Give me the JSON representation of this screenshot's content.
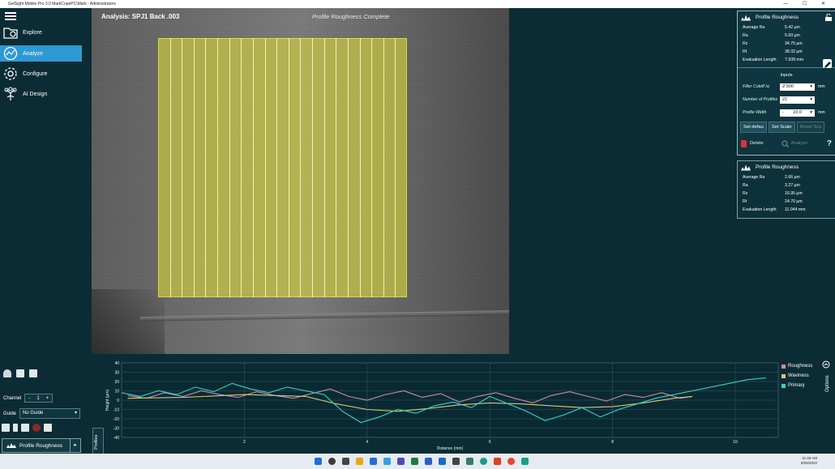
{
  "window": {
    "title": "GelSight Mobile Pro 3.0   MarkCopePC\\Mark - Administrators"
  },
  "nav": {
    "items": [
      {
        "label": "Explore",
        "icon": "folder-search-icon",
        "active": false
      },
      {
        "label": "Analyze",
        "icon": "analyze-icon",
        "active": true
      },
      {
        "label": "Configure",
        "icon": "gear-icon",
        "active": false
      },
      {
        "label": "AI Design",
        "icon": "ai-tree-icon",
        "active": false
      }
    ]
  },
  "viewer": {
    "title": "Analysis: SPJ1 Back .003",
    "status": "Profile Roughness  Complete",
    "roi_color": "#d6d63c",
    "profile_lines": 21
  },
  "panel1": {
    "title": "Profile Roughness",
    "metrics": [
      {
        "k": "Average Ra",
        "v": "5.42 µm"
      },
      {
        "k": "Ra",
        "v": "5.69 µm"
      },
      {
        "k": "Rz",
        "v": "34.75 µm"
      },
      {
        "k": "Rt",
        "v": "38.32 µm"
      },
      {
        "k": "Evaluation Length",
        "v": "7.939 mm"
      }
    ],
    "inputs_title": "Inputs",
    "filter_label": "Filter Cutoff λc",
    "filter_value": "2.500",
    "filter_unit": "mm",
    "profiles_label": "Number of Profiles",
    "profiles_value": "21",
    "width_label": "Profile Width",
    "width_value": "10.0",
    "width_unit": "mm",
    "buttons": {
      "set_default": "Set defau",
      "set_scale": "Set Scale",
      "reset_scale": "Reset Sca"
    },
    "delete_label": "Delete",
    "analyze_label": "Analyze",
    "help_label": "?"
  },
  "panel2": {
    "title": "Profile Roughness",
    "metrics": [
      {
        "k": "Average Ra",
        "v": "2.66 µm"
      },
      {
        "k": "Ra",
        "v": "3.27 µm"
      },
      {
        "k": "Rz",
        "v": "16.95 µm"
      },
      {
        "k": "Rt",
        "v": "24.70 µm"
      },
      {
        "k": "Evaluation Length",
        "v": "11.044 mm"
      }
    ]
  },
  "controls": {
    "channel_label": "Channel",
    "channel_value": "1",
    "guide_label": "Guide",
    "guide_value": "No Guide",
    "profile_button": "Profile Roughness",
    "profiles_tab": "Profiles",
    "options_tab": "Options"
  },
  "chart_data": {
    "type": "line",
    "xlabel": "Distance (mm)",
    "ylabel": "Height (µm)",
    "xlim": [
      0,
      10.7
    ],
    "ylim": [
      -40,
      40
    ],
    "xticks": [
      2,
      4,
      6,
      8,
      10
    ],
    "yticks": [
      -40,
      -30,
      -20,
      -10,
      0,
      10,
      20,
      30,
      40
    ],
    "grid": true,
    "legend_position": "right",
    "series": [
      {
        "name": "Roughness",
        "color": "#c98bb0",
        "x": [
          0.1,
          0.4,
          0.7,
          1.0,
          1.3,
          1.6,
          1.9,
          2.2,
          2.5,
          2.8,
          3.1,
          3.4,
          3.7,
          4.0,
          4.3,
          4.6,
          4.9,
          5.2,
          5.5,
          5.8,
          6.1,
          6.4,
          6.7,
          7.0,
          7.3,
          7.6,
          7.9,
          8.2,
          8.5,
          8.8,
          9.1,
          9.3
        ],
        "y": [
          5,
          2,
          8,
          4,
          10,
          6,
          3,
          9,
          5,
          2,
          7,
          12,
          4,
          0,
          6,
          10,
          3,
          7,
          -2,
          4,
          8,
          2,
          -3,
          5,
          9,
          4,
          -1,
          6,
          3,
          8,
          2,
          4
        ]
      },
      {
        "name": "Waviness",
        "color": "#d8c977",
        "x": [
          0.1,
          1.0,
          2.0,
          3.0,
          3.5,
          4.0,
          4.5,
          5.0,
          5.5,
          6.0,
          6.5,
          7.0,
          7.5,
          8.0,
          8.5,
          9.0,
          9.3
        ],
        "y": [
          2,
          3,
          6,
          4,
          -4,
          -10,
          -12,
          -9,
          -5,
          -3,
          -4,
          -6,
          -8,
          -7,
          -3,
          2,
          4
        ]
      },
      {
        "name": "Primary",
        "color": "#35d3c9",
        "x": [
          0.0,
          0.3,
          0.6,
          0.9,
          1.2,
          1.5,
          1.8,
          2.1,
          2.4,
          2.7,
          3.0,
          3.3,
          3.6,
          3.9,
          4.2,
          4.5,
          4.8,
          5.1,
          5.4,
          5.7,
          6.0,
          6.3,
          6.6,
          6.9,
          7.2,
          7.5,
          7.8,
          8.1,
          8.4,
          8.7,
          9.0,
          9.3,
          9.6,
          9.9,
          10.2,
          10.5
        ],
        "y": [
          8,
          4,
          10,
          6,
          14,
          9,
          18,
          12,
          8,
          14,
          10,
          6,
          -12,
          -24,
          -18,
          -10,
          -14,
          -6,
          -2,
          -8,
          4,
          -4,
          -12,
          -22,
          -16,
          -8,
          -18,
          -10,
          -4,
          2,
          6,
          10,
          14,
          18,
          22,
          24
        ]
      }
    ]
  },
  "taskbar": {
    "time": "11:46 AM",
    "date": "8/25/2022"
  }
}
